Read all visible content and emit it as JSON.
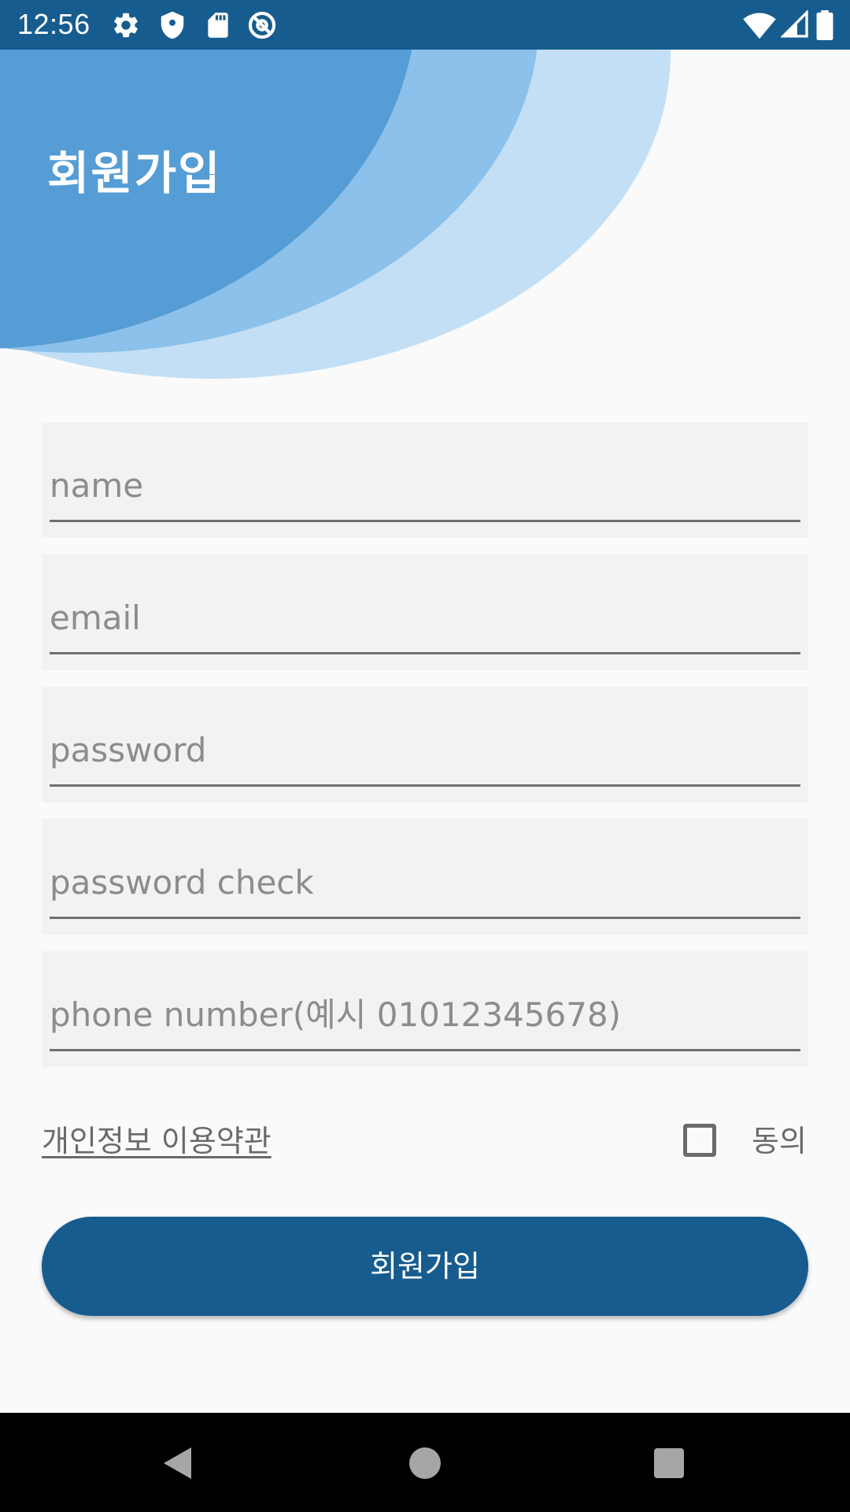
{
  "status_bar": {
    "time": "12:56",
    "left_icons": [
      "settings-icon",
      "shield-icon",
      "sd-card-icon",
      "at-sign-icon"
    ],
    "right_icons": [
      "wifi-icon",
      "signal-icon",
      "battery-icon"
    ],
    "background": "#175c8f"
  },
  "header": {
    "title": "회원가입",
    "wave_colors": [
      "#c3dff5",
      "#8bc1ea",
      "#559dd4"
    ]
  },
  "form": {
    "name": {
      "placeholder": "name",
      "value": ""
    },
    "email": {
      "placeholder": "email",
      "value": ""
    },
    "password": {
      "placeholder": "password",
      "value": ""
    },
    "password_check": {
      "placeholder": "password check",
      "value": ""
    },
    "phone": {
      "placeholder": "phone number(예시 01012345678)",
      "value": ""
    }
  },
  "terms": {
    "link_label": "개인정보 이용약관",
    "agree_label": "동의",
    "agree_checked": false
  },
  "submit": {
    "label": "회원가입",
    "color": "#175c8f"
  },
  "nav_bar": {
    "icons": [
      "back-icon",
      "home-icon",
      "recents-icon"
    ]
  }
}
